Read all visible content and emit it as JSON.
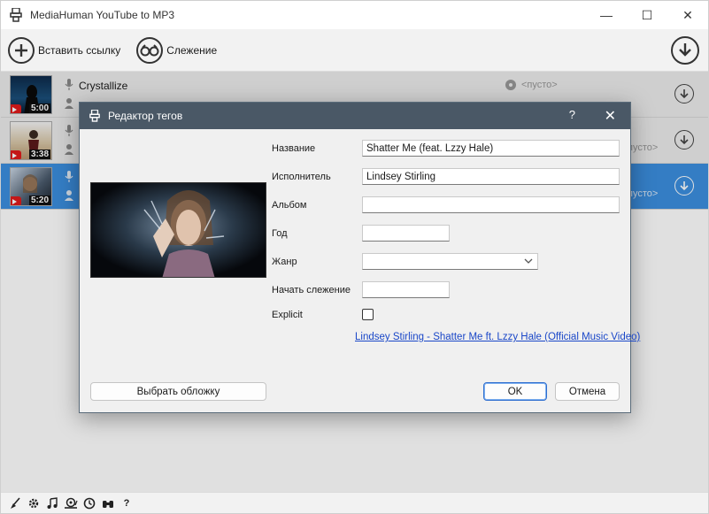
{
  "window": {
    "title": "MediaHuman YouTube to MP3",
    "minimize": "—",
    "maximize": "☐",
    "close": "✕"
  },
  "toolbar": {
    "paste_label": "Вставить ссылку",
    "tracking_label": "Слежение"
  },
  "tracks": [
    {
      "title": "Crystallize",
      "duration": "5:00",
      "empty_label": "<пусто>",
      "right_text": "пусто>"
    },
    {
      "title": "",
      "duration": "3:38",
      "empty_label": "",
      "right_text": "пусто>"
    },
    {
      "title": "",
      "duration": "5:20",
      "empty_label": "",
      "right_text": "пусто>"
    }
  ],
  "dialog": {
    "title": "Редактор тегов",
    "help": "?",
    "close": "✕",
    "labels": {
      "name": "Название",
      "artist": "Исполнитель",
      "album": "Альбом",
      "year": "Год",
      "genre": "Жанр",
      "start_tracking": "Начать слежение",
      "explicit": "Explicit"
    },
    "values": {
      "name": "Shatter Me (feat. Lzzy Hale)",
      "artist": "Lindsey Stirling",
      "album": "",
      "year": "",
      "genre": "",
      "start_tracking": "",
      "explicit": false
    },
    "video_link": "Lindsey Stirling - Shatter Me ft. Lzzy Hale (Official Music Video)",
    "choose_cover": "Выбрать обложку",
    "ok": "OK",
    "cancel": "Отмена"
  },
  "statusbar": {
    "icons": [
      "broom-icon",
      "gear-icon",
      "music-note-icon",
      "snail-icon",
      "clock-icon",
      "binoculars-icon",
      "help-icon"
    ],
    "help_glyph": "?"
  },
  "colors": {
    "selected_row": "#3c8fe0",
    "dialog_title": "#4a5866",
    "link": "#1a47c8"
  }
}
